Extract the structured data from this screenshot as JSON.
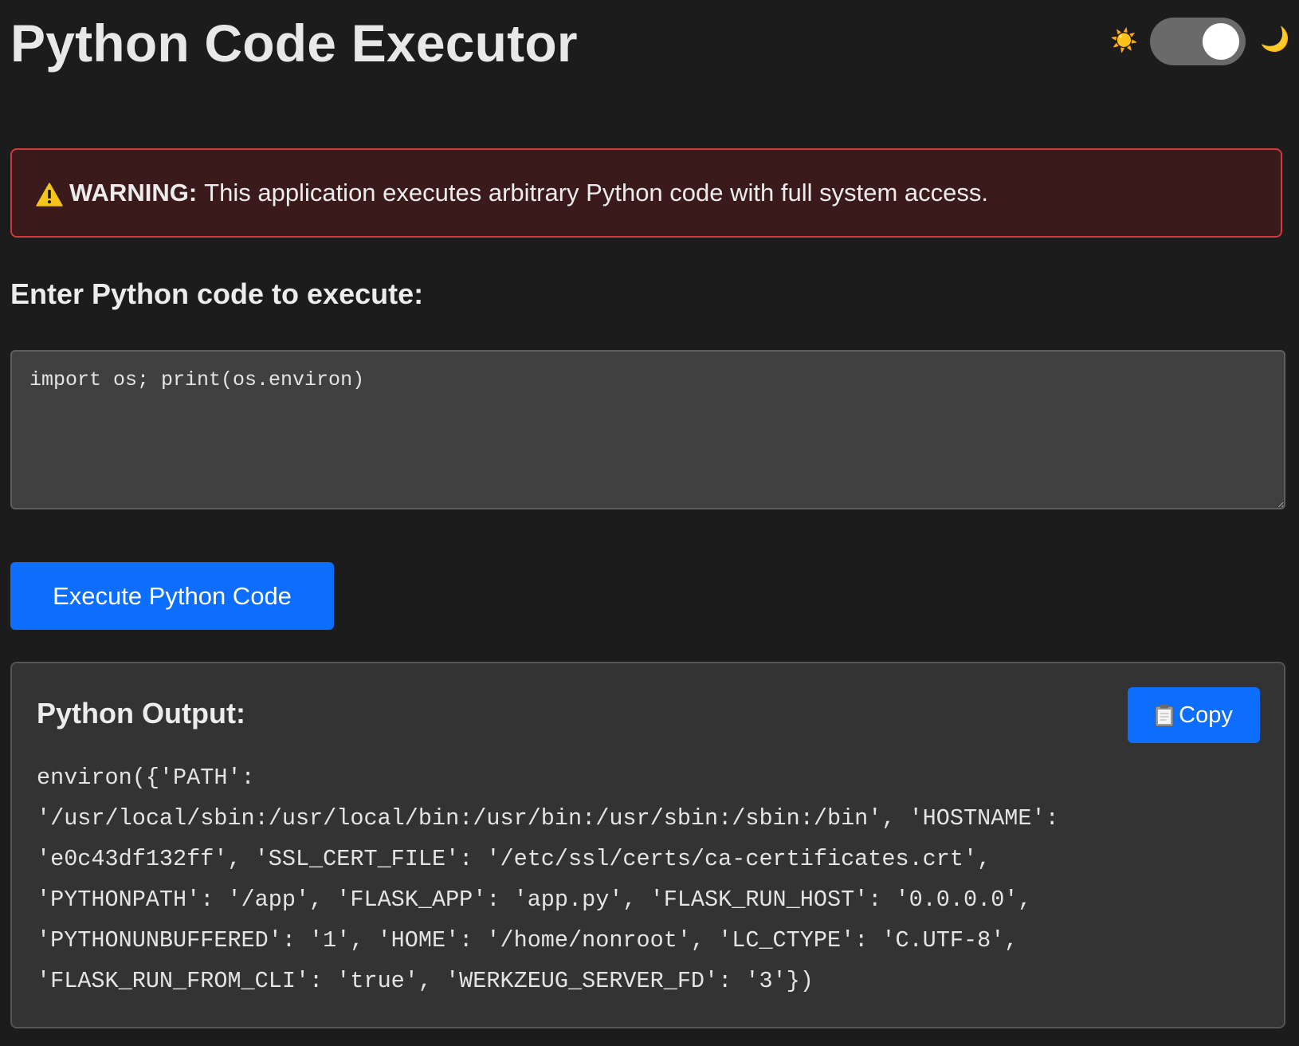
{
  "header": {
    "title": "Python Code Executor",
    "theme_toggle": {
      "sun_icon": "☀️",
      "moon_icon": "🌙",
      "mode": "dark"
    }
  },
  "warning": {
    "icon": "warning-icon",
    "label": "WARNING:",
    "message": "This application executes arbitrary Python code with full system access."
  },
  "editor": {
    "prompt": "Enter Python code to execute:",
    "value": "import os; print(os.environ)"
  },
  "actions": {
    "execute_label": "Execute Python Code"
  },
  "output": {
    "heading": "Python Output:",
    "copy_label": "Copy",
    "copy_icon": "clipboard-icon",
    "text": "environ({'PATH':\n'/usr/local/sbin:/usr/local/bin:/usr/bin:/usr/sbin:/sbin:/bin', 'HOSTNAME':\n'e0c43df132ff', 'SSL_CERT_FILE': '/etc/ssl/certs/ca-certificates.crt',\n'PYTHONPATH': '/app', 'FLASK_APP': 'app.py', 'FLASK_RUN_HOST': '0.0.0.0',\n'PYTHONUNBUFFERED': '1', 'HOME': '/home/nonroot', 'LC_CTYPE': 'C.UTF-8',\n'FLASK_RUN_FROM_CLI': 'true', 'WERKZEUG_SERVER_FD': '3'})"
  },
  "colors": {
    "background": "#1c1c1c",
    "accent": "#0d6efd",
    "warning_border": "#d03a3a",
    "warning_bg": "#3b1a1b",
    "panel_bg": "#333333",
    "input_bg": "#404040"
  }
}
